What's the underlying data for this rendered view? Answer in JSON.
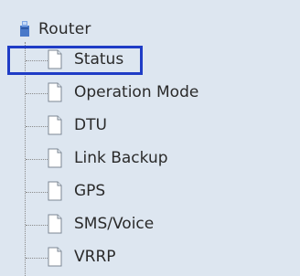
{
  "tree": {
    "root": {
      "label": "Router",
      "icon": "router-icon"
    },
    "items": [
      {
        "label": "Status",
        "icon": "document-icon",
        "selected": true
      },
      {
        "label": "Operation Mode",
        "icon": "document-icon",
        "selected": false
      },
      {
        "label": "DTU",
        "icon": "document-icon",
        "selected": false
      },
      {
        "label": "Link Backup",
        "icon": "document-icon",
        "selected": false
      },
      {
        "label": "GPS",
        "icon": "document-icon",
        "selected": false
      },
      {
        "label": "SMS/Voice",
        "icon": "document-icon",
        "selected": false
      },
      {
        "label": "VRRP",
        "icon": "document-icon",
        "selected": false
      }
    ]
  },
  "colors": {
    "background": "#dde6f0",
    "selection_border": "#1f3cc6",
    "text": "#2a2a2a"
  }
}
